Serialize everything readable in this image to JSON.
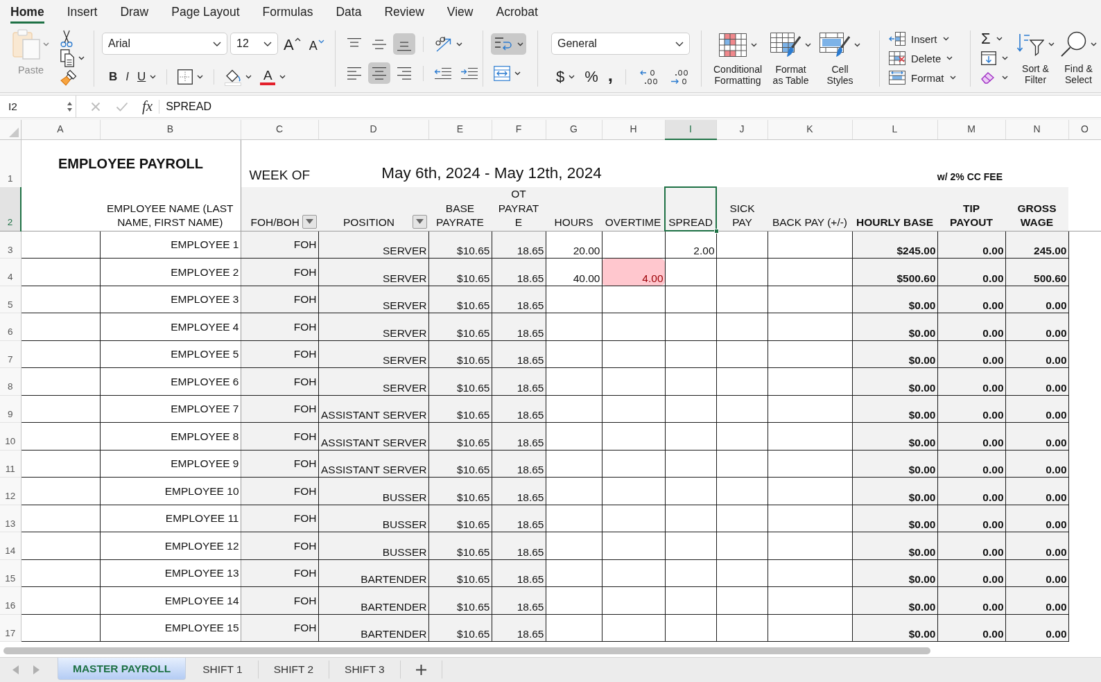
{
  "ribbon_tabs": [
    {
      "label": "Home",
      "selected": true
    },
    {
      "label": "Insert",
      "selected": false
    },
    {
      "label": "Draw",
      "selected": false
    },
    {
      "label": "Page Layout",
      "selected": false
    },
    {
      "label": "Formulas",
      "selected": false
    },
    {
      "label": "Data",
      "selected": false
    },
    {
      "label": "Review",
      "selected": false
    },
    {
      "label": "View",
      "selected": false
    },
    {
      "label": "Acrobat",
      "selected": false
    }
  ],
  "clipboard": {
    "paste": {
      "label": "Paste",
      "disabled": true
    }
  },
  "font": {
    "name": "Arial",
    "size": "12",
    "grow_label": "A",
    "shrink_label": "A",
    "styles": [
      {
        "kind": "bold",
        "label": "B"
      },
      {
        "kind": "italic",
        "label": "I"
      },
      {
        "kind": "underline",
        "label": "U"
      }
    ],
    "color_label": "A"
  },
  "alignment": {
    "vertical": [
      {
        "kind": "top",
        "selected": false
      },
      {
        "kind": "middle",
        "selected": false
      },
      {
        "kind": "bottom",
        "selected": true
      }
    ],
    "horizontal": [
      {
        "kind": "left",
        "selected": false
      },
      {
        "kind": "center",
        "selected": true
      },
      {
        "kind": "right",
        "selected": false
      }
    ],
    "wrap_text": {
      "selected": true
    }
  },
  "number": {
    "format": "General",
    "buttons": [
      {
        "kind": "currency",
        "label": "$"
      },
      {
        "kind": "percent",
        "label": "%"
      },
      {
        "kind": "comma",
        "label": ","
      }
    ]
  },
  "styles": [
    {
      "kind": "conditional",
      "label": "Conditional\nFormatting"
    },
    {
      "kind": "table",
      "label": "Format\nas Table"
    },
    {
      "kind": "cell",
      "label": "Cell\nStyles"
    }
  ],
  "cells": [
    {
      "kind": "insert",
      "label": "Insert"
    },
    {
      "kind": "delete",
      "label": "Delete"
    },
    {
      "kind": "format",
      "label": "Format"
    }
  ],
  "editing": {
    "autosum_label": "Σ",
    "buttons": [
      {
        "kind": "sort",
        "label": "Sort &\nFilter"
      },
      {
        "kind": "find",
        "label": "Find &\nSelect"
      }
    ]
  },
  "formula_bar": {
    "name_box": "I2",
    "edit_disabled": true,
    "function_label": "fx",
    "formula": "SPREAD"
  },
  "columns": [
    {
      "label": "A",
      "selected": false
    },
    {
      "label": "B",
      "selected": false
    },
    {
      "label": "C",
      "selected": false
    },
    {
      "label": "D",
      "selected": false
    },
    {
      "label": "E",
      "selected": false
    },
    {
      "label": "F",
      "selected": false
    },
    {
      "label": "G",
      "selected": false
    },
    {
      "label": "H",
      "selected": false
    },
    {
      "label": "I",
      "selected": true
    },
    {
      "label": "J",
      "selected": false
    },
    {
      "label": "K",
      "selected": false
    },
    {
      "label": "L",
      "selected": false
    },
    {
      "label": "M",
      "selected": false
    },
    {
      "label": "N",
      "selected": false
    },
    {
      "label": "O",
      "selected": false
    }
  ],
  "row_headers": [
    {
      "label": "1",
      "selected": false
    },
    {
      "label": "2",
      "selected": true
    },
    {
      "label": "3",
      "selected": false
    },
    {
      "label": "4",
      "selected": false
    },
    {
      "label": "5",
      "selected": false
    },
    {
      "label": "6",
      "selected": false
    },
    {
      "label": "7",
      "selected": false
    },
    {
      "label": "8",
      "selected": false
    },
    {
      "label": "9",
      "selected": false
    },
    {
      "label": "10",
      "selected": false
    },
    {
      "label": "11",
      "selected": false
    },
    {
      "label": "12",
      "selected": false
    },
    {
      "label": "13",
      "selected": false
    },
    {
      "label": "14",
      "selected": false
    },
    {
      "label": "15",
      "selected": false
    },
    {
      "label": "16",
      "selected": false
    },
    {
      "label": "17",
      "selected": false
    }
  ],
  "sheet": {
    "title": "EMPLOYEE PAYROLL",
    "week_label": "WEEK OF",
    "week_range": "May 6th, 2024 - May 12th, 2024",
    "fee_note": "w/ 2% CC FEE",
    "headers": [
      {
        "text": "EMPLOYEE NAME (LAST\nNAME, FIRST NAME)",
        "filter": false,
        "selected": false
      },
      {
        "text": "FOH/BOH",
        "filter": true,
        "selected": false
      },
      {
        "text": "POSITION",
        "filter": true,
        "selected": false
      },
      {
        "text": "BASE\nPAYRATE",
        "filter": false,
        "selected": false
      },
      {
        "text": "OT\nPAYRAT\nE",
        "filter": false,
        "selected": false
      },
      {
        "text": "HOURS",
        "filter": false,
        "selected": false
      },
      {
        "text": "OVERTIME",
        "filter": false,
        "selected": false
      },
      {
        "text": "SPREAD",
        "filter": false,
        "selected": true
      },
      {
        "text": "SICK\nPAY",
        "filter": false,
        "selected": false
      },
      {
        "text": "BACK PAY (+/-)",
        "filter": false,
        "selected": false
      },
      {
        "text": "HOURLY BASE",
        "filter": false,
        "selected": false
      },
      {
        "text": "TIP\nPAYOUT",
        "filter": false,
        "selected": false
      },
      {
        "text": "GROSS\nWAGE",
        "filter": false,
        "selected": false
      }
    ],
    "rows": [
      {
        "name": "EMPLOYEE 1",
        "foh_boh": "FOH",
        "position": "SERVER",
        "base_payrate": "$10.65",
        "ot_payrate": "18.65",
        "hours": "20.00",
        "spread": "2.00",
        "hourly_base": "$245.00",
        "tip_payout": "0.00",
        "gross_wage": "245.00"
      },
      {
        "name": "EMPLOYEE 2",
        "foh_boh": "FOH",
        "position": "SERVER",
        "base_payrate": "$10.65",
        "ot_payrate": "18.65",
        "hours": "40.00",
        "overtime": {
          "value": "4.00",
          "alert": true
        },
        "hourly_base": "$500.60",
        "tip_payout": "0.00",
        "gross_wage": "500.60"
      },
      {
        "name": "EMPLOYEE 3",
        "foh_boh": "FOH",
        "position": "SERVER",
        "base_payrate": "$10.65",
        "ot_payrate": "18.65",
        "hourly_base": "$0.00",
        "tip_payout": "0.00",
        "gross_wage": "0.00"
      },
      {
        "name": "EMPLOYEE 4",
        "foh_boh": "FOH",
        "position": "SERVER",
        "base_payrate": "$10.65",
        "ot_payrate": "18.65",
        "hourly_base": "$0.00",
        "tip_payout": "0.00",
        "gross_wage": "0.00"
      },
      {
        "name": "EMPLOYEE 5",
        "foh_boh": "FOH",
        "position": "SERVER",
        "base_payrate": "$10.65",
        "ot_payrate": "18.65",
        "hourly_base": "$0.00",
        "tip_payout": "0.00",
        "gross_wage": "0.00"
      },
      {
        "name": "EMPLOYEE 6",
        "foh_boh": "FOH",
        "position": "SERVER",
        "base_payrate": "$10.65",
        "ot_payrate": "18.65",
        "hourly_base": "$0.00",
        "tip_payout": "0.00",
        "gross_wage": "0.00"
      },
      {
        "name": "EMPLOYEE 7",
        "foh_boh": "FOH",
        "position": "ASSISTANT SERVER",
        "base_payrate": "$10.65",
        "ot_payrate": "18.65",
        "hourly_base": "$0.00",
        "tip_payout": "0.00",
        "gross_wage": "0.00"
      },
      {
        "name": "EMPLOYEE 8",
        "foh_boh": "FOH",
        "position": "ASSISTANT SERVER",
        "base_payrate": "$10.65",
        "ot_payrate": "18.65",
        "hourly_base": "$0.00",
        "tip_payout": "0.00",
        "gross_wage": "0.00"
      },
      {
        "name": "EMPLOYEE 9",
        "foh_boh": "FOH",
        "position": "ASSISTANT SERVER",
        "base_payrate": "$10.65",
        "ot_payrate": "18.65",
        "hourly_base": "$0.00",
        "tip_payout": "0.00",
        "gross_wage": "0.00"
      },
      {
        "name": "EMPLOYEE 10",
        "foh_boh": "FOH",
        "position": "BUSSER",
        "base_payrate": "$10.65",
        "ot_payrate": "18.65",
        "hourly_base": "$0.00",
        "tip_payout": "0.00",
        "gross_wage": "0.00"
      },
      {
        "name": "EMPLOYEE 11",
        "foh_boh": "FOH",
        "position": "BUSSER",
        "base_payrate": "$10.65",
        "ot_payrate": "18.65",
        "hourly_base": "$0.00",
        "tip_payout": "0.00",
        "gross_wage": "0.00"
      },
      {
        "name": "EMPLOYEE 12",
        "foh_boh": "FOH",
        "position": "BUSSER",
        "base_payrate": "$10.65",
        "ot_payrate": "18.65",
        "hourly_base": "$0.00",
        "tip_payout": "0.00",
        "gross_wage": "0.00"
      },
      {
        "name": "EMPLOYEE 13",
        "foh_boh": "FOH",
        "position": "BARTENDER",
        "base_payrate": "$10.65",
        "ot_payrate": "18.65",
        "hourly_base": "$0.00",
        "tip_payout": "0.00",
        "gross_wage": "0.00"
      },
      {
        "name": "EMPLOYEE 14",
        "foh_boh": "FOH",
        "position": "BARTENDER",
        "base_payrate": "$10.65",
        "ot_payrate": "18.65",
        "hourly_base": "$0.00",
        "tip_payout": "0.00",
        "gross_wage": "0.00"
      },
      {
        "name": "EMPLOYEE 15",
        "foh_boh": "FOH",
        "position": "BARTENDER",
        "base_payrate": "$10.65",
        "ot_payrate": "18.65",
        "hourly_base": "$0.00",
        "tip_payout": "0.00",
        "gross_wage": "0.00"
      }
    ]
  },
  "sheet_tabs": [
    {
      "label": "MASTER PAYROLL",
      "selected": true
    },
    {
      "label": "SHIFT 1",
      "selected": false
    },
    {
      "label": "SHIFT 2",
      "selected": false
    },
    {
      "label": "SHIFT 3",
      "selected": false
    }
  ]
}
